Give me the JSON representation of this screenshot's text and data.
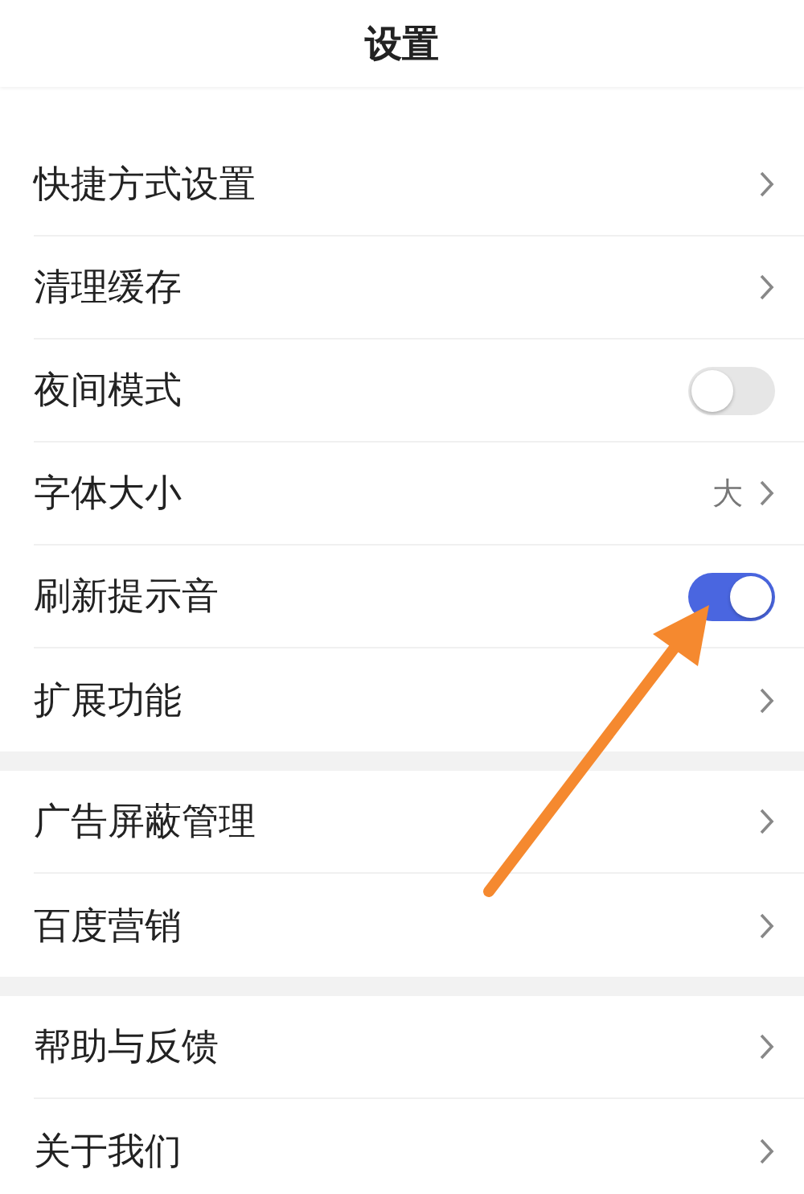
{
  "header": {
    "title": "设置"
  },
  "sections": [
    {
      "rows": [
        {
          "label": "快捷方式设置",
          "kind": "link"
        },
        {
          "label": "清理缓存",
          "kind": "link"
        },
        {
          "label": "夜间模式",
          "kind": "toggle",
          "on": false
        },
        {
          "label": "字体大小",
          "kind": "link",
          "value": "大"
        },
        {
          "label": "刷新提示音",
          "kind": "toggle",
          "on": true
        },
        {
          "label": "扩展功能",
          "kind": "link"
        }
      ]
    },
    {
      "rows": [
        {
          "label": "广告屏蔽管理",
          "kind": "link"
        },
        {
          "label": "百度营销",
          "kind": "link"
        }
      ]
    },
    {
      "rows": [
        {
          "label": "帮助与反馈",
          "kind": "link"
        },
        {
          "label": "关于我们",
          "kind": "link"
        }
      ]
    }
  ],
  "annotation": {
    "kind": "arrow"
  }
}
